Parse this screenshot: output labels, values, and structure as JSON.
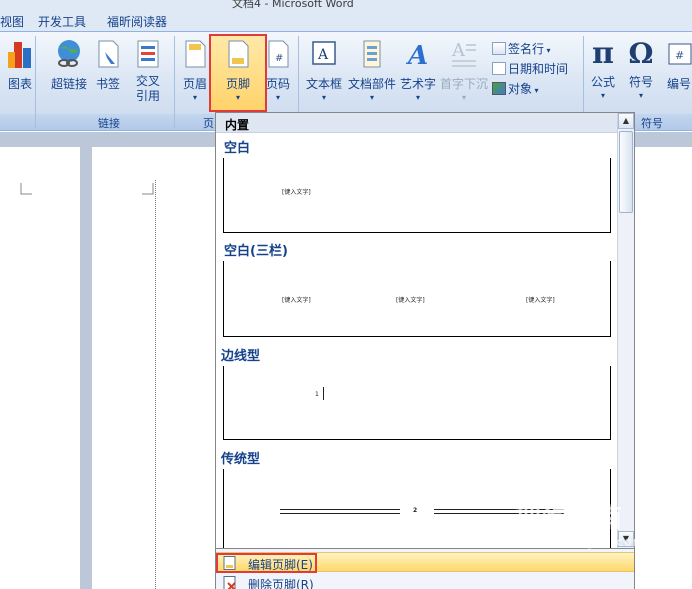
{
  "window": {
    "title": "文档4 - Microsoft Word"
  },
  "tabs": [
    "视图",
    "开发工具",
    "福昕阅读器"
  ],
  "ribbon": {
    "buttons": {
      "chart": "图表",
      "hyperlink": "超链接",
      "bookmark": "书签",
      "cross_ref": "交叉引用",
      "header": "页眉",
      "footer": "页脚",
      "page_number": "页码",
      "textbox": "文本框",
      "quick_parts": "文档部件",
      "wordart": "艺术字",
      "dropcap": "首字下沉",
      "signature_line": "签名行",
      "date_time": "日期和时间",
      "object": "对象",
      "equation": "公式",
      "symbol": "符号",
      "numbering": "编号"
    },
    "group_labels": {
      "links": "链接",
      "header_footer_cut": "页",
      "symbols_cut": "符号"
    }
  },
  "gallery": {
    "header": "内置",
    "sections": [
      {
        "title": "空白",
        "placeholder": "[键入文字]"
      },
      {
        "title": "空白(三栏)",
        "placeholders": [
          "[键入文字]",
          "[键入文字]",
          "[键入文字]"
        ]
      },
      {
        "title": "边线型",
        "page_number": "1"
      },
      {
        "title": "传统型",
        "page_number": "2"
      }
    ]
  },
  "menu": {
    "edit_footer": "编辑页脚(E)",
    "remove_footer": "删除页脚(R)"
  },
  "watermark": {
    "main": "搜狗指南",
    "sub": "zhinan.sogou.com"
  }
}
